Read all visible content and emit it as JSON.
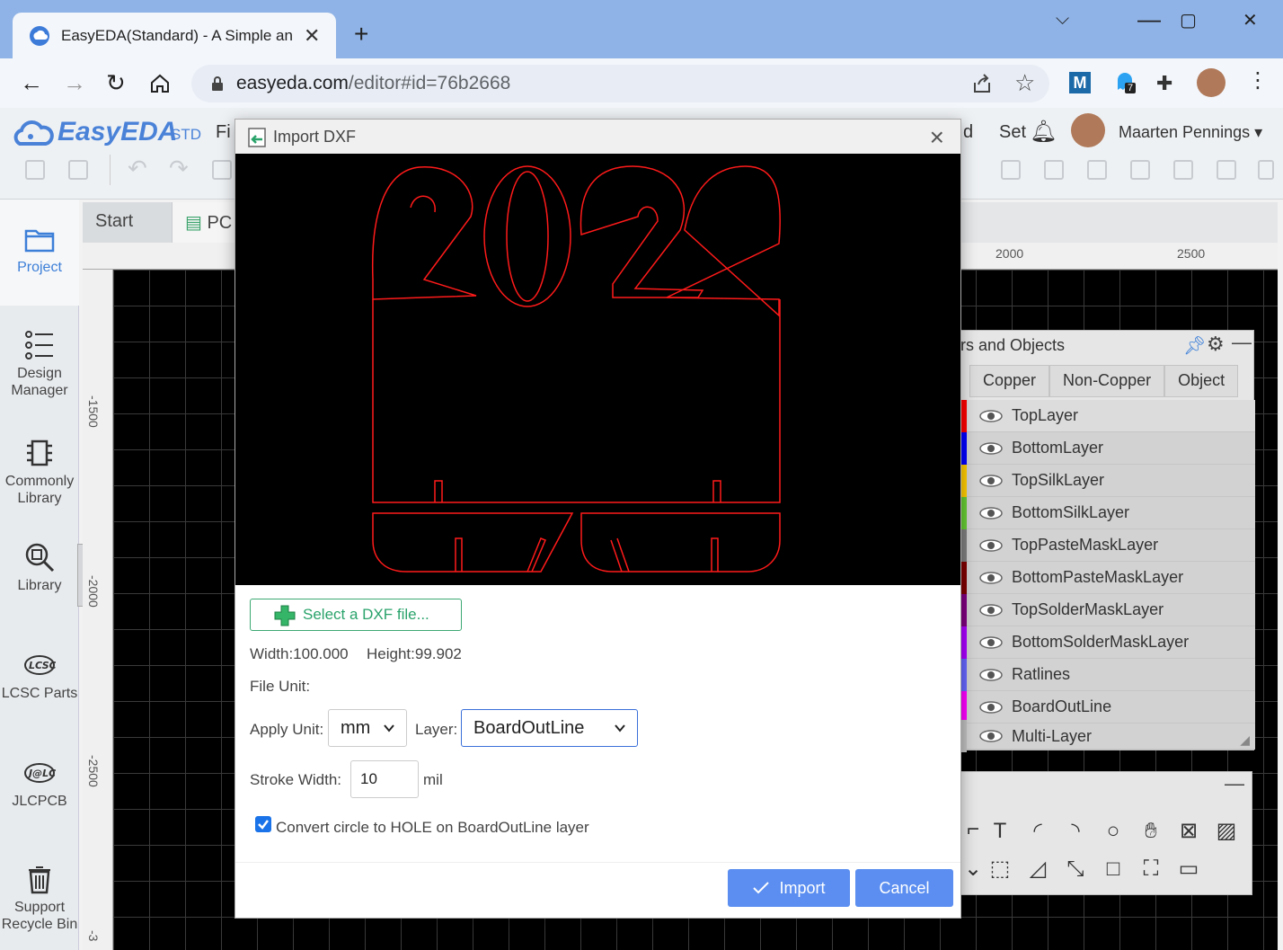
{
  "browser": {
    "tab_title": "EasyEDA(Standard) - A Simple an",
    "url_host": "easyeda.com",
    "url_path": "/editor#id=76b2668",
    "extension_badge": "7"
  },
  "app": {
    "logo": "EasyEDA",
    "logo_suffix": "STD",
    "menu_fi": "Fi",
    "menu_ed": "d",
    "menu_set": "Set",
    "user_name": "Maarten Pennings"
  },
  "sidebar": {
    "items": [
      {
        "label": "Project"
      },
      {
        "label": "Design Manager"
      },
      {
        "label": "Commonly Library"
      },
      {
        "label": "Library"
      },
      {
        "label": "LCSC Parts"
      },
      {
        "label": "JLCPCB"
      },
      {
        "label": "Support Recycle Bin"
      }
    ]
  },
  "doc_tabs": [
    {
      "label": "Start"
    },
    {
      "label": "PC"
    }
  ],
  "ruler": {
    "top": [
      "2000",
      "2500"
    ],
    "left": [
      "-1500",
      "-2000",
      "-2500",
      "-3"
    ]
  },
  "layers_panel": {
    "title": "rs and Objects",
    "tabs": [
      "Copper",
      "Non-Copper",
      "Object"
    ],
    "layers": [
      {
        "name": "TopLayer",
        "color": "#ff0000"
      },
      {
        "name": "BottomLayer",
        "color": "#0000ff"
      },
      {
        "name": "TopSilkLayer",
        "color": "#ffcc00"
      },
      {
        "name": "BottomSilkLayer",
        "color": "#66cc33"
      },
      {
        "name": "TopPasteMaskLayer",
        "color": "#808080"
      },
      {
        "name": "BottomPasteMaskLayer",
        "color": "#800000"
      },
      {
        "name": "TopSolderMaskLayer",
        "color": "#800080"
      },
      {
        "name": "BottomSolderMaskLayer",
        "color": "#aa00ff"
      },
      {
        "name": "Ratlines",
        "color": "#6666ff"
      },
      {
        "name": "BoardOutLine",
        "color": "#ff00ff"
      },
      {
        "name": "Multi-Layer",
        "color": "#c0c0c0"
      }
    ]
  },
  "dialog": {
    "title": "Import DXF",
    "select_file": "Select a DXF file...",
    "width_text": "Width:100.000",
    "height_text": "Height:99.902",
    "file_unit_label": "File Unit:",
    "apply_unit_label": "Apply Unit:",
    "apply_unit_value": "mm",
    "layer_label": "Layer:",
    "layer_value": "BoardOutLine",
    "stroke_width_label": "Stroke Width:",
    "stroke_width_value": "10",
    "stroke_unit": "mil",
    "convert_checkbox_label": "Convert circle to HOLE on BoardOutLine layer",
    "convert_checked": true,
    "import_label": "Import",
    "cancel_label": "Cancel",
    "accent_color": "#5b8ef0",
    "preview_stroke": "#ff1a1a"
  }
}
